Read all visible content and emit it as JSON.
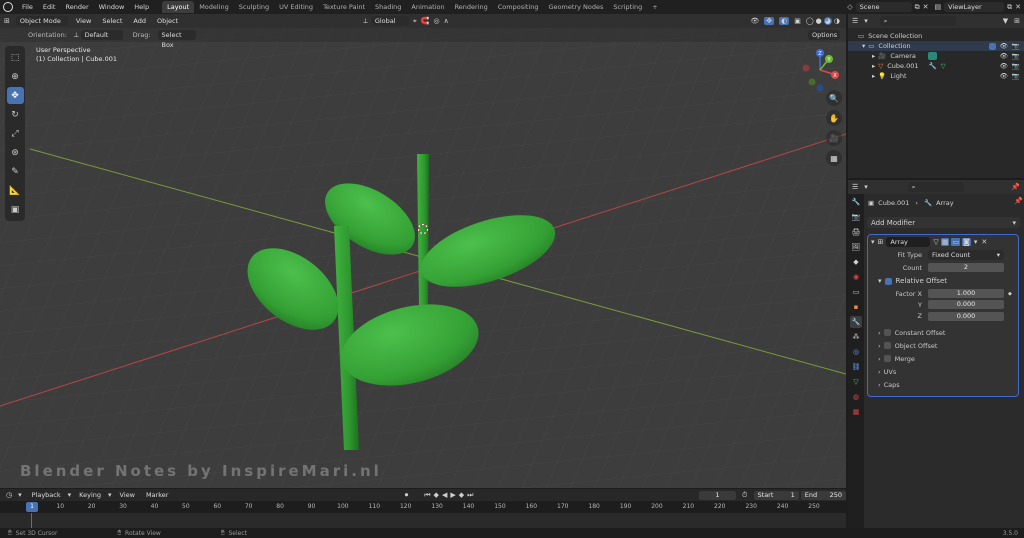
{
  "menu": {
    "items": [
      "File",
      "Edit",
      "Render",
      "Window",
      "Help"
    ],
    "workspaces": [
      {
        "label": "Layout",
        "active": true
      },
      {
        "label": "Modeling"
      },
      {
        "label": "Sculpting"
      },
      {
        "label": "UV Editing"
      },
      {
        "label": "Texture Paint"
      },
      {
        "label": "Shading"
      },
      {
        "label": "Animation"
      },
      {
        "label": "Rendering"
      },
      {
        "label": "Compositing"
      },
      {
        "label": "Geometry Nodes"
      },
      {
        "label": "Scripting"
      }
    ],
    "add_tab": "+",
    "scene": "Scene",
    "view_layer": "ViewLayer"
  },
  "viewport": {
    "mode": "Object Mode",
    "menus": [
      "View",
      "Select",
      "Add",
      "Object"
    ],
    "orientation_label": "Orientation:",
    "orientation_value": "Default",
    "drag_label": "Drag:",
    "drag_value": "Select Box",
    "transform_space": "Global",
    "options": "Options",
    "perspective": "User Perspective",
    "collection_info": "(1) Collection | Cube.001",
    "watermark": "Blender Notes by InspireMari.nl",
    "gizmo": {
      "x": "X",
      "y": "Y",
      "z": "Z"
    }
  },
  "outliner": {
    "scene_collection": "Scene Collection",
    "collection": "Collection",
    "items": [
      {
        "label": "Camera",
        "icon_color": "#e88a4a"
      },
      {
        "label": "Cube.001",
        "icon_color": "#e88a4a",
        "selected": true
      },
      {
        "label": "Light",
        "icon_color": "#e88a4a"
      }
    ]
  },
  "properties": {
    "object": "Cube.001",
    "modifier_breadcrumb": "Array",
    "add_modifier": "Add Modifier",
    "modifier_name": "Array",
    "fit_type_label": "Fit Type",
    "fit_type_value": "Fixed Count",
    "count_label": "Count",
    "count_value": "2",
    "relative_offset": "Relative Offset",
    "factor_x_label": "Factor X",
    "factor_x": "1.000",
    "y_label": "Y",
    "y_value": "0.000",
    "z_label": "Z",
    "z_value": "0.000",
    "subpanels": [
      "Constant Offset",
      "Object Offset",
      "Merge",
      "UVs",
      "Caps"
    ]
  },
  "timeline": {
    "menus": [
      "Playback",
      "Keying",
      "View",
      "Marker"
    ],
    "current_frame": "1",
    "start_label": "Start",
    "start": "1",
    "end_label": "End",
    "end": "250",
    "ticks": [
      "1",
      "10",
      "20",
      "30",
      "40",
      "50",
      "60",
      "70",
      "80",
      "90",
      "100",
      "110",
      "120",
      "130",
      "140",
      "150",
      "160",
      "170",
      "180",
      "190",
      "200",
      "210",
      "220",
      "230",
      "240",
      "250"
    ]
  },
  "status": {
    "left": "Set 3D Cursor",
    "middle": "Rotate View",
    "right": "Select",
    "version": "3.5.0"
  },
  "colors": {
    "accent": "#4772b3",
    "leaf": "#3aa53a",
    "x_axis": "#d44a4a",
    "y_axis": "#8ab83a"
  }
}
